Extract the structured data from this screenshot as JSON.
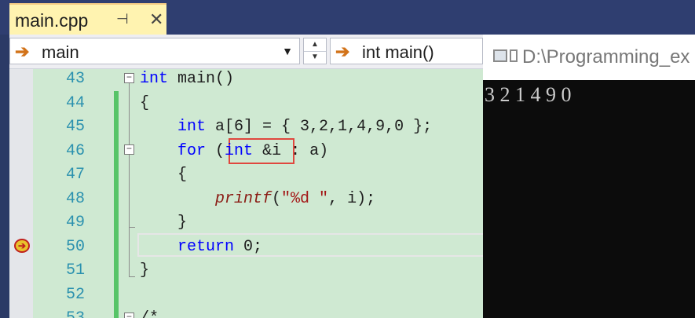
{
  "tab": {
    "title": "main.cpp",
    "pin_glyph": "⊣",
    "close_glyph": "✕"
  },
  "navbar": {
    "scope": "main",
    "member": "int main()"
  },
  "editor": {
    "line_numbers": [
      "43",
      "44",
      "45",
      "46",
      "47",
      "48",
      "49",
      "50",
      "51",
      "52",
      "53"
    ],
    "lines": [
      {
        "parts": [
          {
            "t": "int",
            "c": "kw"
          },
          {
            "t": " main()"
          }
        ]
      },
      {
        "parts": [
          {
            "t": "{"
          }
        ]
      },
      {
        "parts": [
          {
            "t": "    "
          },
          {
            "t": "int",
            "c": "kw"
          },
          {
            "t": " a[6] = { 3,2,1,4,9,0 };"
          }
        ]
      },
      {
        "parts": [
          {
            "t": "    "
          },
          {
            "t": "for",
            "c": "kw"
          },
          {
            "t": " ("
          },
          {
            "t": "int",
            "c": "kw"
          },
          {
            "t": " &i : a)"
          }
        ]
      },
      {
        "parts": [
          {
            "t": "    {"
          }
        ]
      },
      {
        "parts": [
          {
            "t": "        "
          },
          {
            "t": "printf",
            "c": "fn"
          },
          {
            "t": "("
          },
          {
            "t": "\"%d \"",
            "c": "str"
          },
          {
            "t": ", i);"
          }
        ]
      },
      {
        "parts": [
          {
            "t": "    }"
          }
        ]
      },
      {
        "parts": [
          {
            "t": "    "
          },
          {
            "t": "return",
            "c": "kw"
          },
          {
            "t": " 0;"
          }
        ]
      },
      {
        "parts": [
          {
            "t": "}"
          }
        ]
      },
      {
        "parts": [
          {
            "t": ""
          }
        ]
      },
      {
        "parts": [
          {
            "t": "/*",
            "c": "cm"
          }
        ]
      }
    ],
    "breakpoint_line": "50",
    "highlight": "int &i"
  },
  "console": {
    "title": "D:\\Programming_ex",
    "output": "3 2 1 4 9 0"
  }
}
